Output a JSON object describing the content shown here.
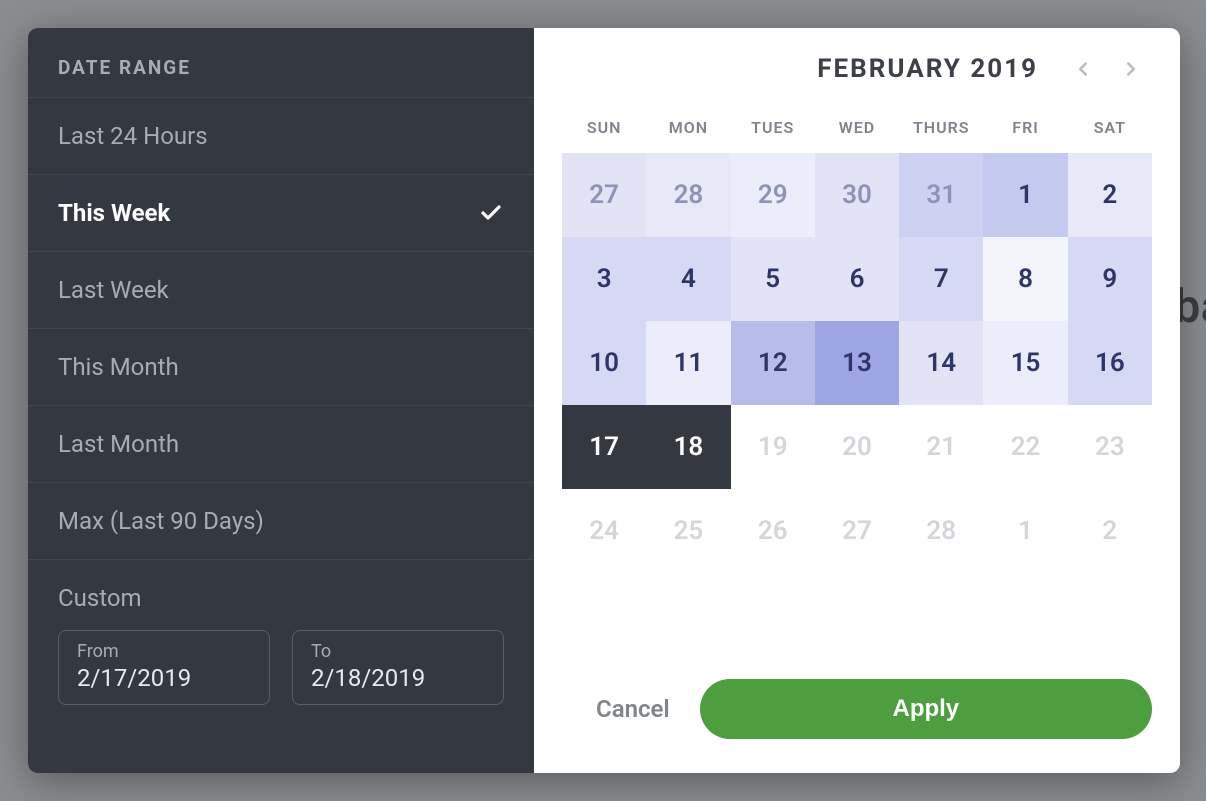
{
  "sidebar": {
    "header": "DATE RANGE",
    "items": [
      {
        "label": "Last 24 Hours",
        "selected": false
      },
      {
        "label": "This Week",
        "selected": true
      },
      {
        "label": "Last Week",
        "selected": false
      },
      {
        "label": "This Month",
        "selected": false
      },
      {
        "label": "Last Month",
        "selected": false
      },
      {
        "label": "Max (Last 90 Days)",
        "selected": false
      }
    ],
    "custom_label": "Custom",
    "from_label": "From",
    "from_value": "2/17/2019",
    "to_label": "To",
    "to_value": "2/18/2019"
  },
  "calendar": {
    "title": "FEBRUARY 2019",
    "dow": [
      "SUN",
      "MON",
      "TUES",
      "WED",
      "THURS",
      "FRI",
      "SAT"
    ],
    "cells": [
      {
        "n": "27",
        "type": "prev",
        "shade": "#e2e4f6"
      },
      {
        "n": "28",
        "type": "prev",
        "shade": "#e7e8f8"
      },
      {
        "n": "29",
        "type": "prev",
        "shade": "#ecedfa"
      },
      {
        "n": "30",
        "type": "prev",
        "shade": "#e2e4f6"
      },
      {
        "n": "31",
        "type": "prev",
        "shade": "#ced2f2"
      },
      {
        "n": "1",
        "type": "cur",
        "shade": "#c4c9ef"
      },
      {
        "n": "2",
        "type": "cur",
        "shade": "#e7e8f8"
      },
      {
        "n": "3",
        "type": "cur",
        "shade": "#d6d9f3"
      },
      {
        "n": "4",
        "type": "cur",
        "shade": "#d6d9f3"
      },
      {
        "n": "5",
        "type": "cur",
        "shade": "#e2e4f6"
      },
      {
        "n": "6",
        "type": "cur",
        "shade": "#e2e4f6"
      },
      {
        "n": "7",
        "type": "cur",
        "shade": "#d6d9f3"
      },
      {
        "n": "8",
        "type": "cur",
        "shade": "#f3f4fc"
      },
      {
        "n": "9",
        "type": "cur",
        "shade": "#d6d9f3"
      },
      {
        "n": "10",
        "type": "cur",
        "shade": "#d6d9f3"
      },
      {
        "n": "11",
        "type": "cur",
        "shade": "#ecedfa"
      },
      {
        "n": "12",
        "type": "cur",
        "shade": "#b7bcea"
      },
      {
        "n": "13",
        "type": "cur",
        "shade": "#9da5e3"
      },
      {
        "n": "14",
        "type": "cur",
        "shade": "#e2e4f6"
      },
      {
        "n": "15",
        "type": "cur",
        "shade": "#ecedfa"
      },
      {
        "n": "16",
        "type": "cur",
        "shade": "#d6d9f3"
      },
      {
        "n": "17",
        "type": "sel"
      },
      {
        "n": "18",
        "type": "sel"
      },
      {
        "n": "19",
        "type": "dis"
      },
      {
        "n": "20",
        "type": "dis"
      },
      {
        "n": "21",
        "type": "dis"
      },
      {
        "n": "22",
        "type": "dis"
      },
      {
        "n": "23",
        "type": "dis"
      },
      {
        "n": "24",
        "type": "dis"
      },
      {
        "n": "25",
        "type": "dis"
      },
      {
        "n": "26",
        "type": "dis"
      },
      {
        "n": "27",
        "type": "dis"
      },
      {
        "n": "28",
        "type": "dis"
      },
      {
        "n": "1",
        "type": "next-dis"
      },
      {
        "n": "2",
        "type": "next-dis"
      }
    ],
    "cancel_label": "Cancel",
    "apply_label": "Apply"
  },
  "colors": {
    "cur_text": "#2e3567",
    "prev_text": "#8e93b8"
  },
  "backdrop_text": "ba"
}
